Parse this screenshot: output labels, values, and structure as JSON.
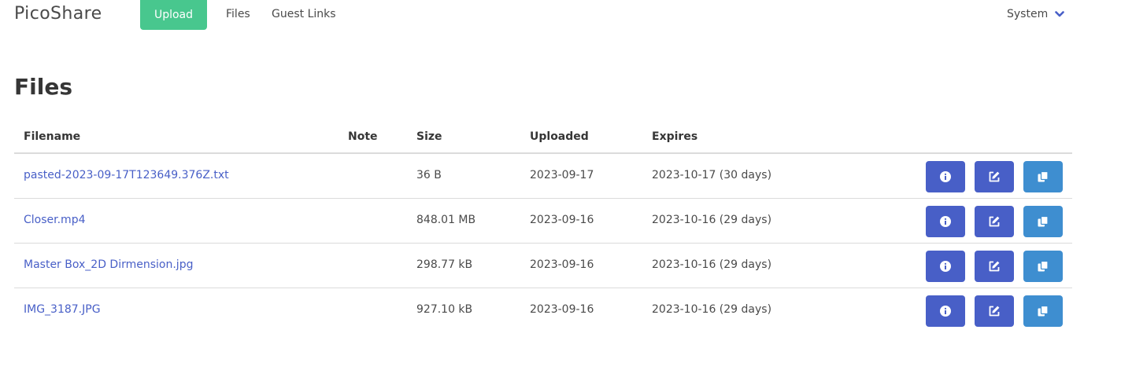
{
  "nav": {
    "brand": "PicoShare",
    "upload_label": "Upload",
    "files_label": "Files",
    "guest_links_label": "Guest Links",
    "system_label": "System"
  },
  "page": {
    "title": "Files"
  },
  "table": {
    "headers": {
      "filename": "Filename",
      "note": "Note",
      "size": "Size",
      "uploaded": "Uploaded",
      "expires": "Expires"
    },
    "rows": [
      {
        "filename": "pasted-2023-09-17T123649.376Z.txt",
        "note": "",
        "size": "36 B",
        "uploaded": "2023-09-17",
        "expires": "2023-10-17 (30 days)"
      },
      {
        "filename": "Closer.mp4",
        "note": "",
        "size": "848.01 MB",
        "uploaded": "2023-09-16",
        "expires": "2023-10-16 (29 days)"
      },
      {
        "filename": "Master Box_2D Dirmension.jpg",
        "note": "",
        "size": "298.77 kB",
        "uploaded": "2023-09-16",
        "expires": "2023-10-16 (29 days)"
      },
      {
        "filename": "IMG_3187.JPG",
        "note": "",
        "size": "927.10 kB",
        "uploaded": "2023-09-16",
        "expires": "2023-10-16 (29 days)"
      }
    ],
    "row_actions": [
      "info-icon",
      "edit-icon",
      "copy-icon"
    ]
  },
  "colors": {
    "upload_button": "#48c78e",
    "link": "#485fc7",
    "primary_button": "#485fc7",
    "copy_button": "#3e8ed0"
  }
}
